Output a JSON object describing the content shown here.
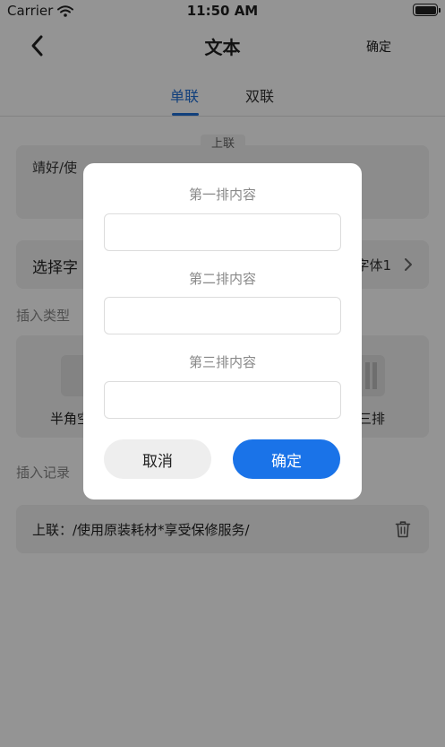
{
  "status_bar": {
    "carrier": "Carrier",
    "time": "11:50 AM"
  },
  "nav": {
    "title": "文本",
    "confirm": "确定"
  },
  "tabs": [
    {
      "label": "单联",
      "active": true
    },
    {
      "label": "双联",
      "active": false
    }
  ],
  "content": {
    "upper_label": "上联",
    "text_value": "靖好/使",
    "font_label": "选择字",
    "font_value": "字体1",
    "insert_type_title": "插入类型",
    "type_items": [
      {
        "label": "半角空"
      },
      {
        "label": "三排"
      }
    ],
    "insert_record_title": "插入记录",
    "record_text": "上联：/使用原装耗材*享受保修服务/"
  },
  "dialog": {
    "line1_label": "第一排内容",
    "line1_value": "",
    "line2_label": "第二排内容",
    "line2_value": "",
    "line3_label": "第三排内容",
    "line3_value": "",
    "cancel": "取消",
    "ok": "确定"
  },
  "colors": {
    "accent": "#1a73e8",
    "tab_active": "#1f6fd6"
  }
}
